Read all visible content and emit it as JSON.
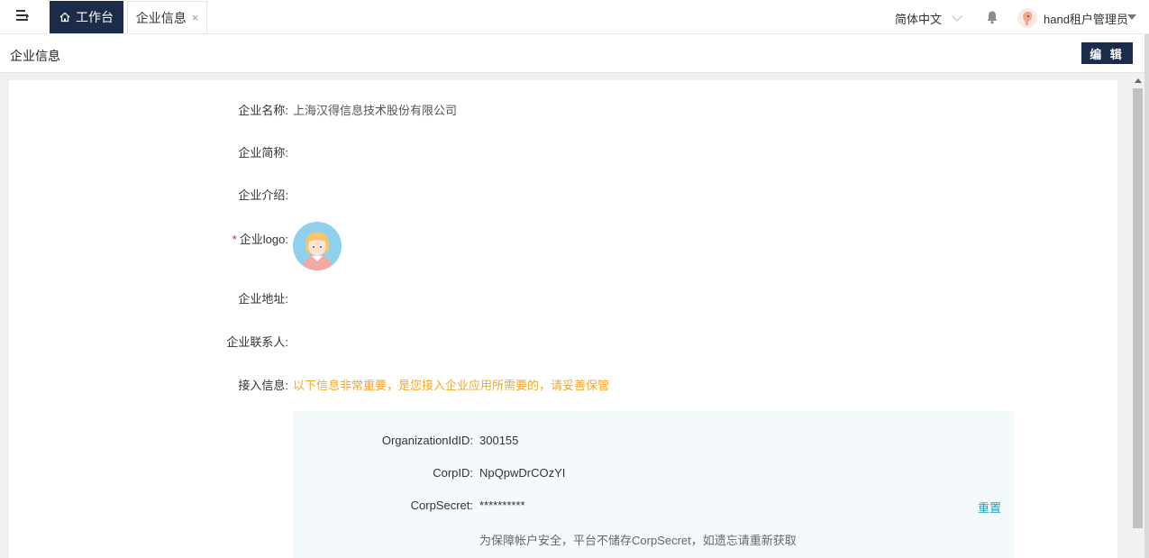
{
  "topbar": {
    "home_tab_label": "工作台",
    "page_tab_label": "企业信息",
    "tab_close": "×",
    "language": "简体中文",
    "user_name": "hand租户管理员"
  },
  "page": {
    "title": "企业信息",
    "edit_label": "编 辑"
  },
  "form": {
    "name_label": "企业名称:",
    "name_value": "上海汉得信息技术股份有限公司",
    "short_name_label": "企业简称:",
    "intro_label": "企业介绍:",
    "logo_required": "*",
    "logo_label": "企业logo:",
    "address_label": "企业地址:",
    "contact_label": "企业联系人:",
    "access_label": "接入信息:",
    "access_warning": "以下信息非常重要，是您接入企业应用所需要的，请妥善保管"
  },
  "access_info": {
    "org_id_label": "OrganizationIdID:",
    "org_id_value": "300155",
    "corp_id_label": "CorpID:",
    "corp_id_value": "NpQpwDrCOzYI",
    "corp_secret_label": "CorpSecret:",
    "corp_secret_value": "**********",
    "reset_label": "重置",
    "hint": "为保障帐户安全，平台不储存CorpSecret，如遗忘请重新获取"
  },
  "colors": {
    "primary": "#1d2b4a",
    "warning": "#f5a623",
    "link": "#1aa3c8",
    "required": "#e02020"
  },
  "icons": [
    "menu-icon",
    "home-icon",
    "close-icon",
    "chevron-down-icon",
    "bell-icon",
    "user-avatar",
    "caret-down-icon"
  ]
}
